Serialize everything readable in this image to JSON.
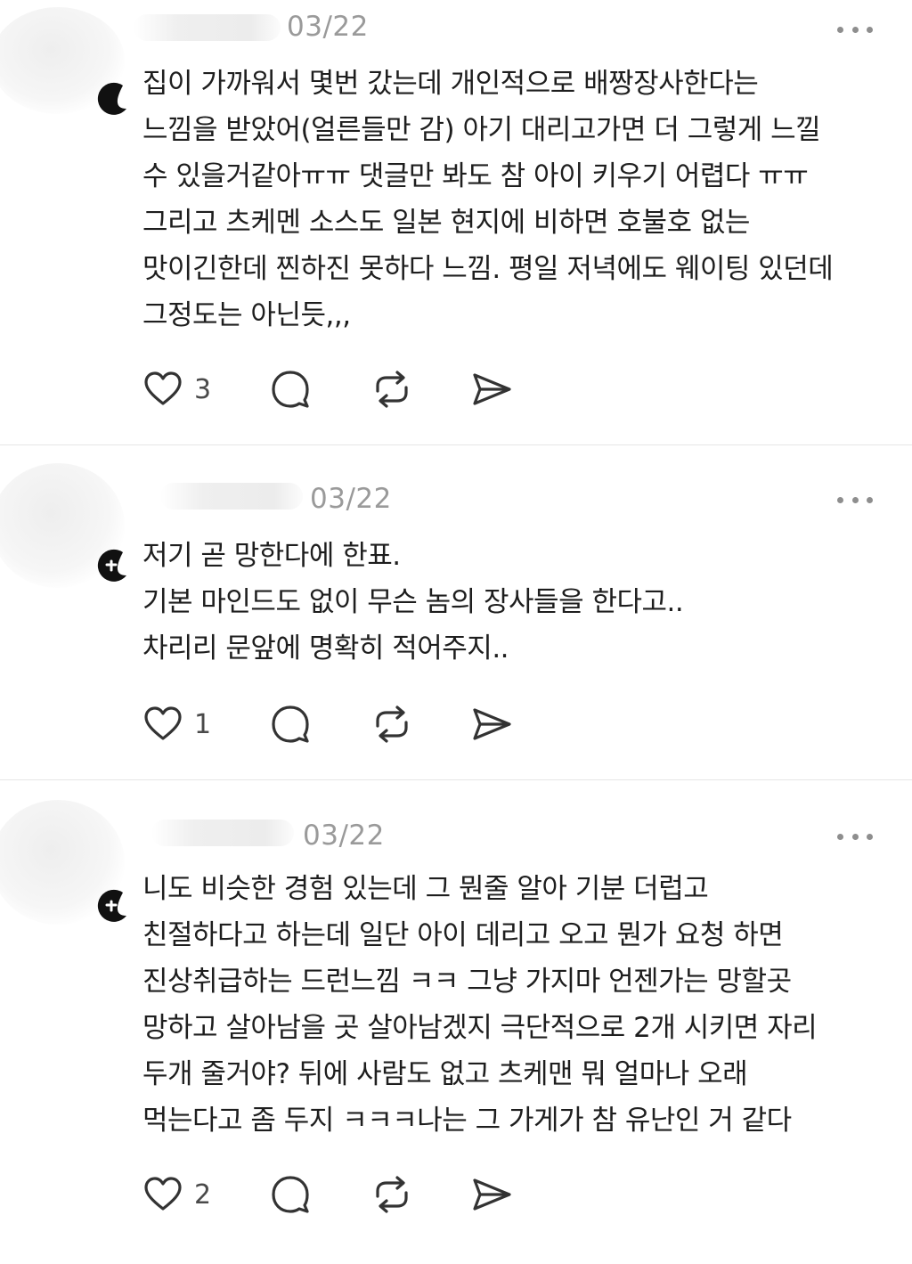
{
  "posts": [
    {
      "date": "03/22",
      "lines": [
        "집이 가까워서 몇번 갔는데 개인적으로 배짱장사한다는",
        "느낌을 받았어(얼른들만 감) 아기 대리고가면 더 그렇게 느낄",
        "수 있을거같아ㅠㅠ 댓글만 봐도 참 아이 키우기 어렵다 ㅠㅠ",
        "그리고 츠케멘 소스도 일본 현지에 비하면 호불호 없는",
        "맛이긴한데 찐하진 못하다 느낌. 평일 저녁에도 웨이팅 있던데",
        "그정도는 아닌듯,,,"
      ],
      "likes": "3"
    },
    {
      "date": "03/22",
      "lines": [
        "저기 곧 망한다에 한표.",
        "기본 마인드도 없이 무슨 놈의 장사들을 한다고..",
        "차리리 문앞에 명확히 적어주지.."
      ],
      "likes": "1"
    },
    {
      "date": "03/22",
      "lines": [
        "니도 비슷한 경험 있는데 그 뭔줄 알아 기분 더럽고",
        "친절하다고 하는데 일단 아이 데리고 오고 뭔가 요청 하면",
        "진상취급하는 드런느낌 ㅋㅋ 그냥 가지마 언젠가는 망할곳",
        "망하고 살아남을 곳 살아남겠지 극단적으로 2개 시키면 자리",
        "두개 줄거야? 뒤에 사람도 없고 츠케맨 뭐 얼마나 오래",
        "먹는다고 좀 두지 ㅋㅋㅋ나는 그 가게가 참 유난인 거 같다"
      ],
      "likes": "2"
    }
  ],
  "icons": {
    "like": "heart-icon",
    "reply": "comment-bubble-icon",
    "repost": "repost-arrows-icon",
    "share": "send-plane-icon",
    "more": "more-dots-icon"
  },
  "colors": {
    "text": "#1e1e1e",
    "meta": "#9a9a9a",
    "icon": "#333333",
    "divider": "#e6e6e6"
  }
}
